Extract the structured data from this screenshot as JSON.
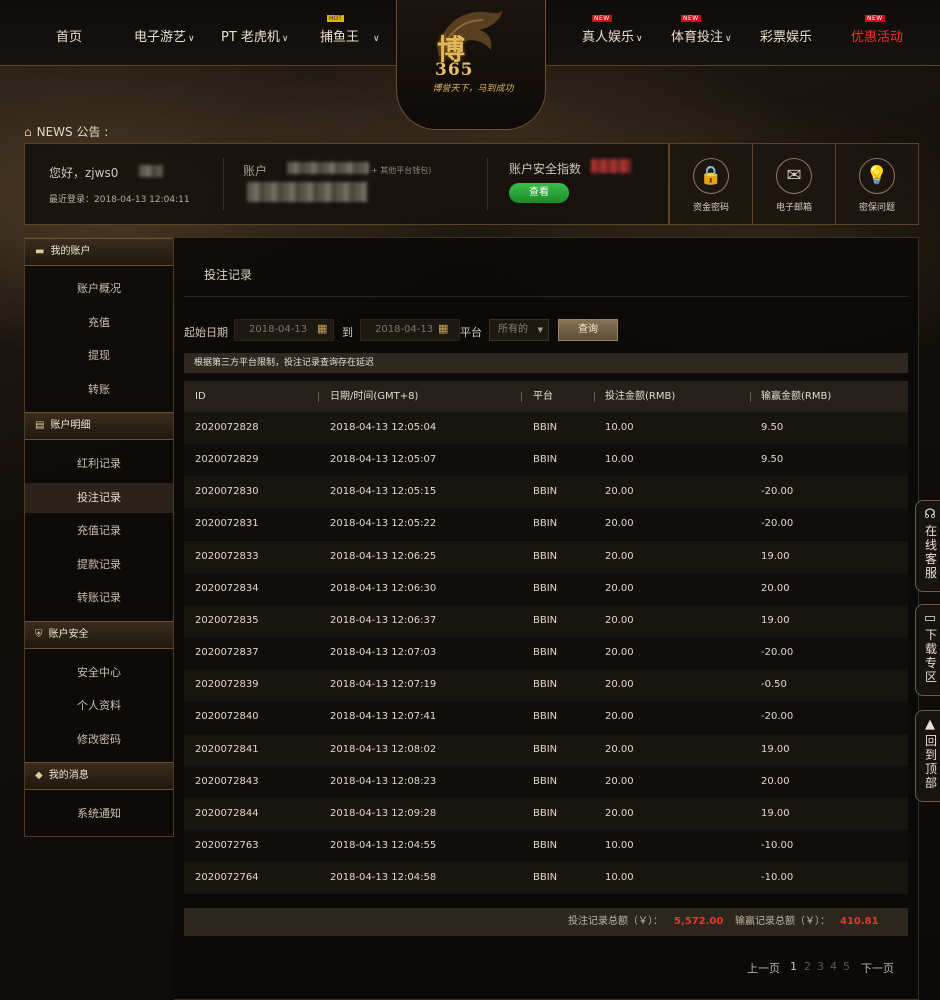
{
  "nav": {
    "items": [
      {
        "label": "首页",
        "chevron": false,
        "badge": ""
      },
      {
        "label": "电子游艺",
        "chevron": true,
        "badge": ""
      },
      {
        "label": "PT 老虎机",
        "chevron": true,
        "badge": ""
      },
      {
        "label": "捕鱼王",
        "chevron": true,
        "badge": "HOT"
      },
      {
        "label": "真人娱乐",
        "chevron": true,
        "badge": "NEW"
      },
      {
        "label": "体育投注",
        "chevron": true,
        "badge": "NEW"
      },
      {
        "label": "彩票娱乐",
        "chevron": false,
        "badge": ""
      },
      {
        "label": "优惠活动",
        "chevron": false,
        "badge": "NEW"
      }
    ],
    "chevron_glyph": "∨",
    "promo_color": "#ff2a2a"
  },
  "logo": {
    "main": "博",
    "number": "365",
    "slogan": "博誉天下，马到成功"
  },
  "news": {
    "label": "NEWS 公告 :"
  },
  "summary": {
    "greeting": "您好，zjws0",
    "last_login": "最近登录：2018-04-13 12:04:11",
    "account_label": "账户",
    "account_note": "+ 其他平台钱包)",
    "security_label": "账户安全指数",
    "check_button": "查看"
  },
  "quick_links": [
    {
      "label": "资金密码",
      "icon": "lock-icon",
      "glyph": "🔒"
    },
    {
      "label": "电子邮箱",
      "icon": "mail-icon",
      "glyph": "✉"
    },
    {
      "label": "密保问题",
      "icon": "bulb-icon",
      "glyph": "💡"
    }
  ],
  "sidebar": {
    "sections": [
      {
        "title": "我的账户",
        "icon": "account-icon",
        "glyph": "▬",
        "items": [
          "账户概况",
          "充值",
          "提现",
          "转账"
        ]
      },
      {
        "title": "账户明细",
        "icon": "detail-icon",
        "glyph": "▤",
        "items": [
          "红利记录",
          "投注记录",
          "充值记录",
          "提款记录",
          "转账记录"
        ]
      },
      {
        "title": "账户安全",
        "icon": "shield-icon",
        "glyph": "⛨",
        "items": [
          "安全中心",
          "个人资料",
          "修改密码"
        ]
      },
      {
        "title": "我的消息",
        "icon": "message-icon",
        "glyph": "◆",
        "items": [
          "系统通知"
        ]
      }
    ],
    "active_item": "投注记录"
  },
  "main": {
    "title": "投注记录",
    "filters": {
      "start_label": "起始日期",
      "start_value": "2018-04-13",
      "to_label": "到",
      "end_value": "2018-04-13",
      "platform_label": "平台",
      "platform_value": "所有的",
      "query_button": "查询"
    },
    "notice": "根据第三方平台限制，投注记录查询存在延迟",
    "columns": [
      "ID",
      "日期/时间(GMT+8)",
      "平台",
      "投注金额(RMB)",
      "输赢金额(RMB)"
    ],
    "rows": [
      [
        "2020072828",
        "2018-04-13 12:05:04",
        "BBIN",
        "10.00",
        "9.50"
      ],
      [
        "2020072829",
        "2018-04-13 12:05:07",
        "BBIN",
        "10.00",
        "9.50"
      ],
      [
        "2020072830",
        "2018-04-13 12:05:15",
        "BBIN",
        "20.00",
        "-20.00"
      ],
      [
        "2020072831",
        "2018-04-13 12:05:22",
        "BBIN",
        "20.00",
        "-20.00"
      ],
      [
        "2020072833",
        "2018-04-13 12:06:25",
        "BBIN",
        "20.00",
        "19.00"
      ],
      [
        "2020072834",
        "2018-04-13 12:06:30",
        "BBIN",
        "20.00",
        "20.00"
      ],
      [
        "2020072835",
        "2018-04-13 12:06:37",
        "BBIN",
        "20.00",
        "19.00"
      ],
      [
        "2020072837",
        "2018-04-13 12:07:03",
        "BBIN",
        "20.00",
        "-20.00"
      ],
      [
        "2020072839",
        "2018-04-13 12:07:19",
        "BBIN",
        "20.00",
        "-0.50"
      ],
      [
        "2020072840",
        "2018-04-13 12:07:41",
        "BBIN",
        "20.00",
        "-20.00"
      ],
      [
        "2020072841",
        "2018-04-13 12:08:02",
        "BBIN",
        "20.00",
        "19.00"
      ],
      [
        "2020072843",
        "2018-04-13 12:08:23",
        "BBIN",
        "20.00",
        "20.00"
      ],
      [
        "2020072844",
        "2018-04-13 12:09:28",
        "BBIN",
        "20.00",
        "19.00"
      ],
      [
        "2020072763",
        "2018-04-13 12:04:55",
        "BBIN",
        "10.00",
        "-10.00"
      ],
      [
        "2020072764",
        "2018-04-13 12:04:58",
        "BBIN",
        "10.00",
        "-10.00"
      ]
    ],
    "totals": {
      "bet_label": "投注记录总额（￥）：",
      "bet_value": "5,572.00",
      "win_label": "输赢记录总额（￥）：",
      "win_value": "410.81"
    },
    "pagination": {
      "prev": "上一页",
      "pages": [
        "1",
        "2",
        "3",
        "4",
        "5"
      ],
      "current": "1",
      "next": "下一页"
    }
  },
  "float_tabs": [
    {
      "label": "在线客服",
      "icon": "headset-icon",
      "glyph": "☊"
    },
    {
      "label": "下载专区",
      "icon": "download-icon",
      "glyph": "▭"
    },
    {
      "label": "回到顶部",
      "icon": "rocket-icon",
      "glyph": "▲"
    }
  ]
}
